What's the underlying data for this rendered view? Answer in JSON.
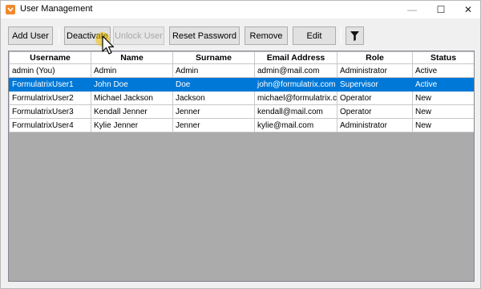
{
  "window": {
    "title": "User Management"
  },
  "window_controls": {
    "minimize": "—",
    "maximize": "☐",
    "close": "✕"
  },
  "toolbar": {
    "add_user": "Add User",
    "deactivate": "Deactivate",
    "unlock_user": "Unlock User",
    "reset_password": "Reset Password",
    "remove": "Remove",
    "edit": "Edit"
  },
  "table": {
    "columns": [
      "Username",
      "Name",
      "Surname",
      "Email Address",
      "Role",
      "Status"
    ],
    "rows": [
      [
        "admin (You)",
        "Admin",
        "Admin",
        "admin@mail.com",
        "Administrator",
        "Active"
      ],
      [
        "FormulatrixUser1",
        "John Doe",
        "Doe",
        "john@formulatrix.com",
        "Supervisor",
        "Active"
      ],
      [
        "FormulatrixUser2",
        "Michael Jackson",
        "Jackson",
        "michael@formulatrix.com",
        "Operator",
        "New"
      ],
      [
        "FormulatrixUser3",
        "Kendall Jenner",
        "Jenner",
        "kendall@mail.com",
        "Operator",
        "New"
      ],
      [
        "FormulatrixUser4",
        "Kylie Jenner",
        "Jenner",
        "kylie@mail.com",
        "Administrator",
        "New"
      ]
    ],
    "selected_row_index": 1
  },
  "colors": {
    "selection": "#0078d7",
    "app_icon": "#f0882c",
    "cursor_glow": "#f5c200"
  }
}
